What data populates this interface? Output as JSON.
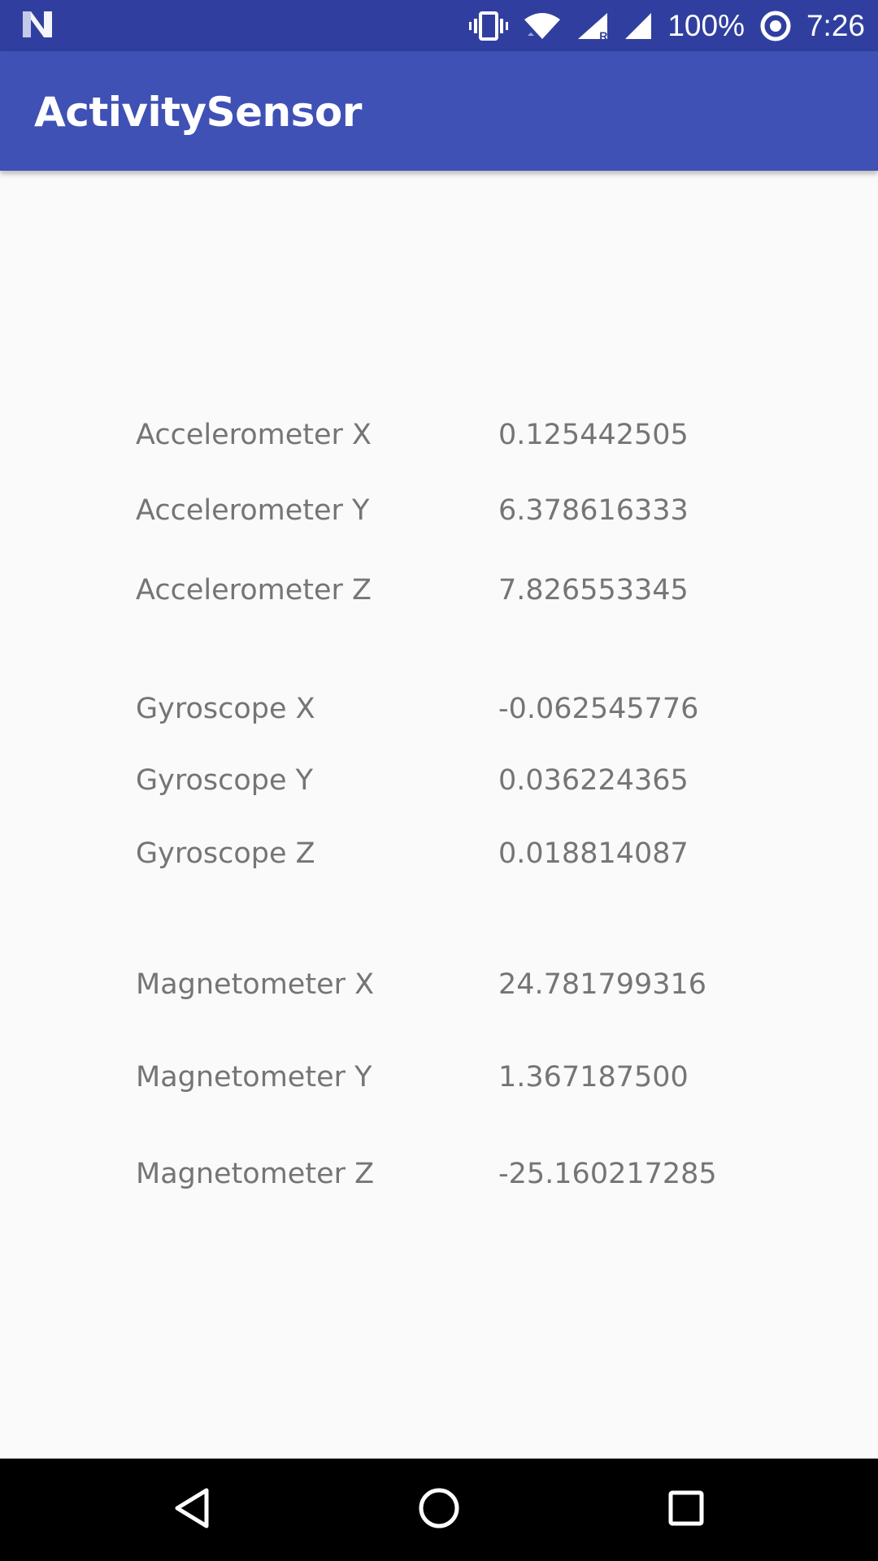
{
  "status_bar": {
    "notification_icon": "n-logo-icon",
    "vibrate_icon": "vibrate-icon",
    "wifi_icon": "wifi-icon",
    "cell_roaming_icon": "cell-signal-roaming-icon",
    "roaming_indicator": "R",
    "cell_icon": "cell-signal-icon",
    "battery": "100%",
    "sync_icon": "target-icon",
    "time": "7:26"
  },
  "app_bar": {
    "title": "ActivitySensor"
  },
  "sensors": {
    "accelerometer": [
      {
        "label": "Accelerometer X",
        "value": "0.125442505"
      },
      {
        "label": "Accelerometer Y",
        "value": "6.378616333"
      },
      {
        "label": "Accelerometer Z",
        "value": "7.826553345"
      }
    ],
    "gyroscope": [
      {
        "label": "Gyroscope X",
        "value": "-0.062545776"
      },
      {
        "label": "Gyroscope Y",
        "value": "0.036224365"
      },
      {
        "label": "Gyroscope Z",
        "value": "0.018814087"
      }
    ],
    "magnetometer": [
      {
        "label": "Magnetometer X",
        "value": "24.781799316"
      },
      {
        "label": "Magnetometer Y",
        "value": "1.367187500"
      },
      {
        "label": "Magnetometer Z",
        "value": "-25.160217285"
      }
    ]
  },
  "nav_bar": {
    "back_icon": "back-triangle-icon",
    "home_icon": "home-circle-icon",
    "recents_icon": "recents-square-icon"
  },
  "colors": {
    "status_bar": "#303f9f",
    "app_bar": "#3f51b5",
    "background": "#fafafa",
    "text": "#757575"
  }
}
